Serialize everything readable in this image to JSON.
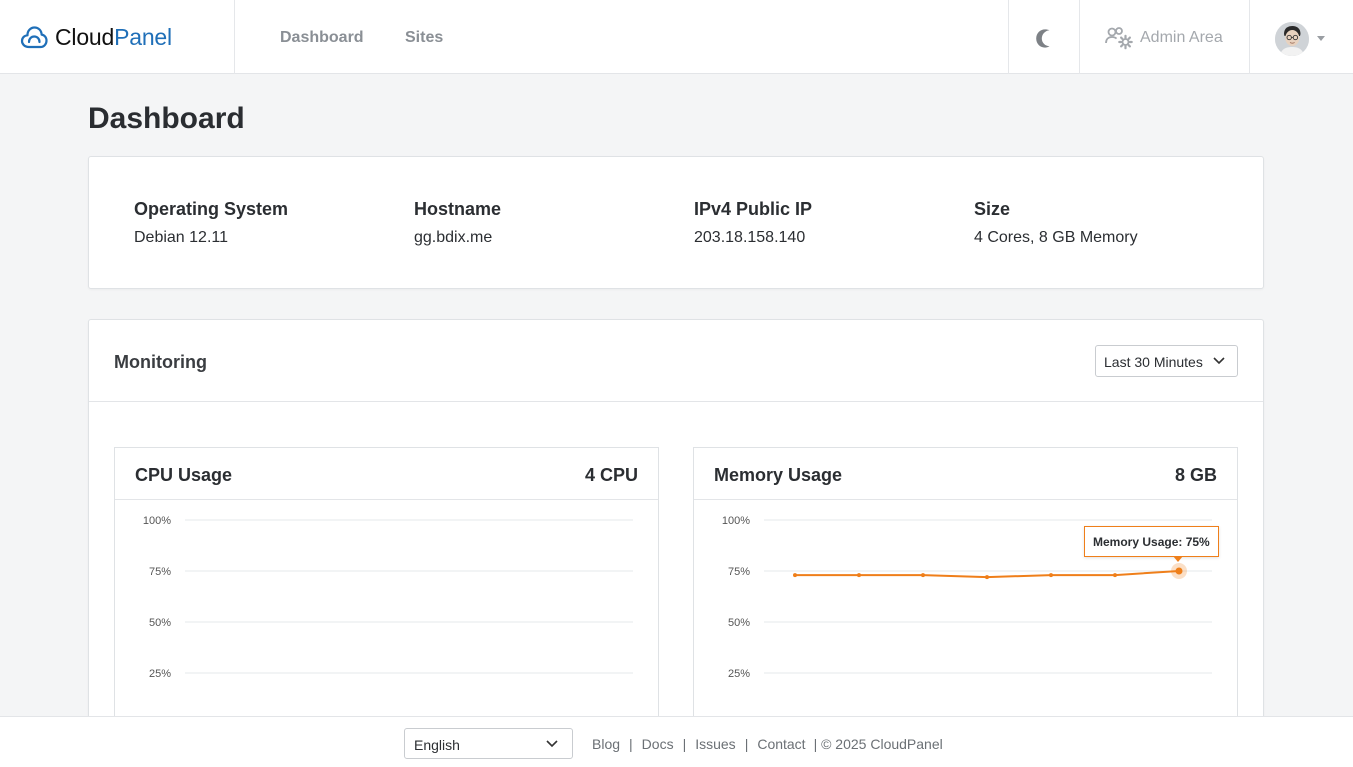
{
  "header": {
    "logo_part1": "Cloud",
    "logo_part2": "Panel",
    "nav": [
      {
        "label": "Dashboard"
      },
      {
        "label": "Sites"
      }
    ],
    "admin_label": "Admin Area"
  },
  "page": {
    "title": "Dashboard"
  },
  "server_info": [
    {
      "label": "Operating System",
      "value": "Debian 12.11"
    },
    {
      "label": "Hostname",
      "value": "gg.bdix.me"
    },
    {
      "label": "IPv4 Public IP",
      "value": "203.18.158.140"
    },
    {
      "label": "Size",
      "value": "4 Cores, 8 GB Memory"
    }
  ],
  "monitoring": {
    "title": "Monitoring",
    "range_selected": "Last 30 Minutes"
  },
  "charts": {
    "cpu": {
      "title": "CPU Usage",
      "meta": "4 CPU"
    },
    "memory": {
      "title": "Memory Usage",
      "meta": "8 GB",
      "tooltip": "Memory Usage: 75%"
    }
  },
  "chart_data": [
    {
      "type": "line",
      "title": "CPU Usage",
      "ylim": [
        0,
        100
      ],
      "y_ticks": [
        "100%",
        "75%",
        "50%",
        "25%"
      ],
      "series": []
    },
    {
      "type": "line",
      "title": "Memory Usage",
      "ylim": [
        0,
        100
      ],
      "y_ticks": [
        "100%",
        "75%",
        "50%",
        "25%"
      ],
      "series": [
        {
          "values": [
            73,
            73,
            73,
            72,
            73,
            73,
            75
          ]
        }
      ],
      "color": "#ef7f1a"
    }
  ],
  "footer": {
    "language": "English",
    "links": [
      "Blog",
      "Docs",
      "Issues",
      "Contact"
    ],
    "copyright": "| © 2025  CloudPanel"
  }
}
